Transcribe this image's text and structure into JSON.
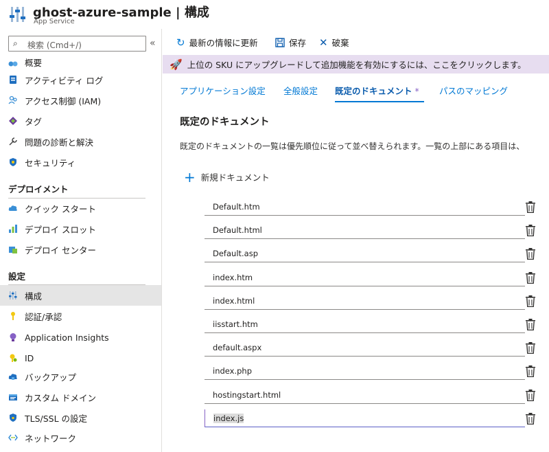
{
  "header": {
    "title": "ghost-azure-sample | 構成",
    "subtitle": "App Service"
  },
  "sidebar": {
    "search_placeholder": "検索 (Cmd+/)",
    "collapse": "«",
    "top_items": [
      {
        "label": "概要",
        "icon": "overview-icon"
      },
      {
        "label": "アクティビティ ログ",
        "icon": "activity-log-icon"
      },
      {
        "label": "アクセス制御 (IAM)",
        "icon": "iam-icon"
      },
      {
        "label": "タグ",
        "icon": "tag-icon"
      },
      {
        "label": "問題の診断と解決",
        "icon": "wrench-icon"
      },
      {
        "label": "セキュリティ",
        "icon": "shield-icon"
      }
    ],
    "deploy_section": {
      "title": "デプロイメント",
      "items": [
        {
          "label": "クイック スタート",
          "icon": "cloud-icon"
        },
        {
          "label": "デプロイ スロット",
          "icon": "slots-icon"
        },
        {
          "label": "デプロイ センター",
          "icon": "deploy-center-icon"
        }
      ]
    },
    "settings_section": {
      "title": "設定",
      "items": [
        {
          "label": "構成",
          "icon": "config-icon"
        },
        {
          "label": "認証/承認",
          "icon": "key-icon"
        },
        {
          "label": "Application Insights",
          "icon": "lightbulb-icon"
        },
        {
          "label": "ID",
          "icon": "identity-icon"
        },
        {
          "label": "バックアップ",
          "icon": "backup-cloud-icon"
        },
        {
          "label": "カスタム ドメイン",
          "icon": "domain-icon"
        },
        {
          "label": "TLS/SSL の設定",
          "icon": "tls-shield-icon"
        },
        {
          "label": "ネットワーク",
          "icon": "network-icon"
        }
      ]
    }
  },
  "toolbar": {
    "refresh": "最新の情報に更新",
    "save": "保存",
    "discard": "破棄"
  },
  "banner": {
    "text": "上位の SKU にアップグレードして追加機能を有効にするには、ここをクリックします。"
  },
  "tabs": [
    {
      "label": "アプリケーション設定"
    },
    {
      "label": "全般設定"
    },
    {
      "label": "既定のドキュメント",
      "modified_mark": "*"
    },
    {
      "label": "パスのマッピング"
    }
  ],
  "main": {
    "title": "既定のドキュメント",
    "description": "既定のドキュメントの一覧は優先順位に従って並べ替えられます。一覧の上部にある項目は、",
    "new_document": "新規ドキュメント",
    "documents": [
      "Default.htm",
      "Default.html",
      "Default.asp",
      "index.htm",
      "index.html",
      "iisstart.htm",
      "default.aspx",
      "index.php",
      "hostingstart.html",
      "index.js"
    ]
  },
  "colors": {
    "accent": "#0078d4",
    "banner_bg": "#e7ddf0",
    "active_nav_bg": "#e5e5e5"
  }
}
